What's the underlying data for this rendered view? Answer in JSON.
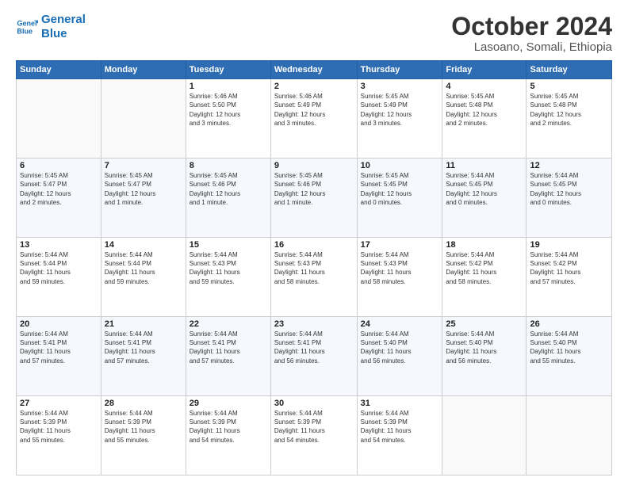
{
  "logo": {
    "line1": "General",
    "line2": "Blue"
  },
  "title": "October 2024",
  "subtitle": "Lasoano, Somali, Ethiopia",
  "header_days": [
    "Sunday",
    "Monday",
    "Tuesday",
    "Wednesday",
    "Thursday",
    "Friday",
    "Saturday"
  ],
  "weeks": [
    [
      {
        "day": "",
        "info": ""
      },
      {
        "day": "",
        "info": ""
      },
      {
        "day": "1",
        "info": "Sunrise: 5:46 AM\nSunset: 5:50 PM\nDaylight: 12 hours\nand 3 minutes."
      },
      {
        "day": "2",
        "info": "Sunrise: 5:46 AM\nSunset: 5:49 PM\nDaylight: 12 hours\nand 3 minutes."
      },
      {
        "day": "3",
        "info": "Sunrise: 5:45 AM\nSunset: 5:49 PM\nDaylight: 12 hours\nand 3 minutes."
      },
      {
        "day": "4",
        "info": "Sunrise: 5:45 AM\nSunset: 5:48 PM\nDaylight: 12 hours\nand 2 minutes."
      },
      {
        "day": "5",
        "info": "Sunrise: 5:45 AM\nSunset: 5:48 PM\nDaylight: 12 hours\nand 2 minutes."
      }
    ],
    [
      {
        "day": "6",
        "info": "Sunrise: 5:45 AM\nSunset: 5:47 PM\nDaylight: 12 hours\nand 2 minutes."
      },
      {
        "day": "7",
        "info": "Sunrise: 5:45 AM\nSunset: 5:47 PM\nDaylight: 12 hours\nand 1 minute."
      },
      {
        "day": "8",
        "info": "Sunrise: 5:45 AM\nSunset: 5:46 PM\nDaylight: 12 hours\nand 1 minute."
      },
      {
        "day": "9",
        "info": "Sunrise: 5:45 AM\nSunset: 5:46 PM\nDaylight: 12 hours\nand 1 minute."
      },
      {
        "day": "10",
        "info": "Sunrise: 5:45 AM\nSunset: 5:45 PM\nDaylight: 12 hours\nand 0 minutes."
      },
      {
        "day": "11",
        "info": "Sunrise: 5:44 AM\nSunset: 5:45 PM\nDaylight: 12 hours\nand 0 minutes."
      },
      {
        "day": "12",
        "info": "Sunrise: 5:44 AM\nSunset: 5:45 PM\nDaylight: 12 hours\nand 0 minutes."
      }
    ],
    [
      {
        "day": "13",
        "info": "Sunrise: 5:44 AM\nSunset: 5:44 PM\nDaylight: 11 hours\nand 59 minutes."
      },
      {
        "day": "14",
        "info": "Sunrise: 5:44 AM\nSunset: 5:44 PM\nDaylight: 11 hours\nand 59 minutes."
      },
      {
        "day": "15",
        "info": "Sunrise: 5:44 AM\nSunset: 5:43 PM\nDaylight: 11 hours\nand 59 minutes."
      },
      {
        "day": "16",
        "info": "Sunrise: 5:44 AM\nSunset: 5:43 PM\nDaylight: 11 hours\nand 58 minutes."
      },
      {
        "day": "17",
        "info": "Sunrise: 5:44 AM\nSunset: 5:43 PM\nDaylight: 11 hours\nand 58 minutes."
      },
      {
        "day": "18",
        "info": "Sunrise: 5:44 AM\nSunset: 5:42 PM\nDaylight: 11 hours\nand 58 minutes."
      },
      {
        "day": "19",
        "info": "Sunrise: 5:44 AM\nSunset: 5:42 PM\nDaylight: 11 hours\nand 57 minutes."
      }
    ],
    [
      {
        "day": "20",
        "info": "Sunrise: 5:44 AM\nSunset: 5:41 PM\nDaylight: 11 hours\nand 57 minutes."
      },
      {
        "day": "21",
        "info": "Sunrise: 5:44 AM\nSunset: 5:41 PM\nDaylight: 11 hours\nand 57 minutes."
      },
      {
        "day": "22",
        "info": "Sunrise: 5:44 AM\nSunset: 5:41 PM\nDaylight: 11 hours\nand 57 minutes."
      },
      {
        "day": "23",
        "info": "Sunrise: 5:44 AM\nSunset: 5:41 PM\nDaylight: 11 hours\nand 56 minutes."
      },
      {
        "day": "24",
        "info": "Sunrise: 5:44 AM\nSunset: 5:40 PM\nDaylight: 11 hours\nand 56 minutes."
      },
      {
        "day": "25",
        "info": "Sunrise: 5:44 AM\nSunset: 5:40 PM\nDaylight: 11 hours\nand 56 minutes."
      },
      {
        "day": "26",
        "info": "Sunrise: 5:44 AM\nSunset: 5:40 PM\nDaylight: 11 hours\nand 55 minutes."
      }
    ],
    [
      {
        "day": "27",
        "info": "Sunrise: 5:44 AM\nSunset: 5:39 PM\nDaylight: 11 hours\nand 55 minutes."
      },
      {
        "day": "28",
        "info": "Sunrise: 5:44 AM\nSunset: 5:39 PM\nDaylight: 11 hours\nand 55 minutes."
      },
      {
        "day": "29",
        "info": "Sunrise: 5:44 AM\nSunset: 5:39 PM\nDaylight: 11 hours\nand 54 minutes."
      },
      {
        "day": "30",
        "info": "Sunrise: 5:44 AM\nSunset: 5:39 PM\nDaylight: 11 hours\nand 54 minutes."
      },
      {
        "day": "31",
        "info": "Sunrise: 5:44 AM\nSunset: 5:39 PM\nDaylight: 11 hours\nand 54 minutes."
      },
      {
        "day": "",
        "info": ""
      },
      {
        "day": "",
        "info": ""
      }
    ]
  ]
}
